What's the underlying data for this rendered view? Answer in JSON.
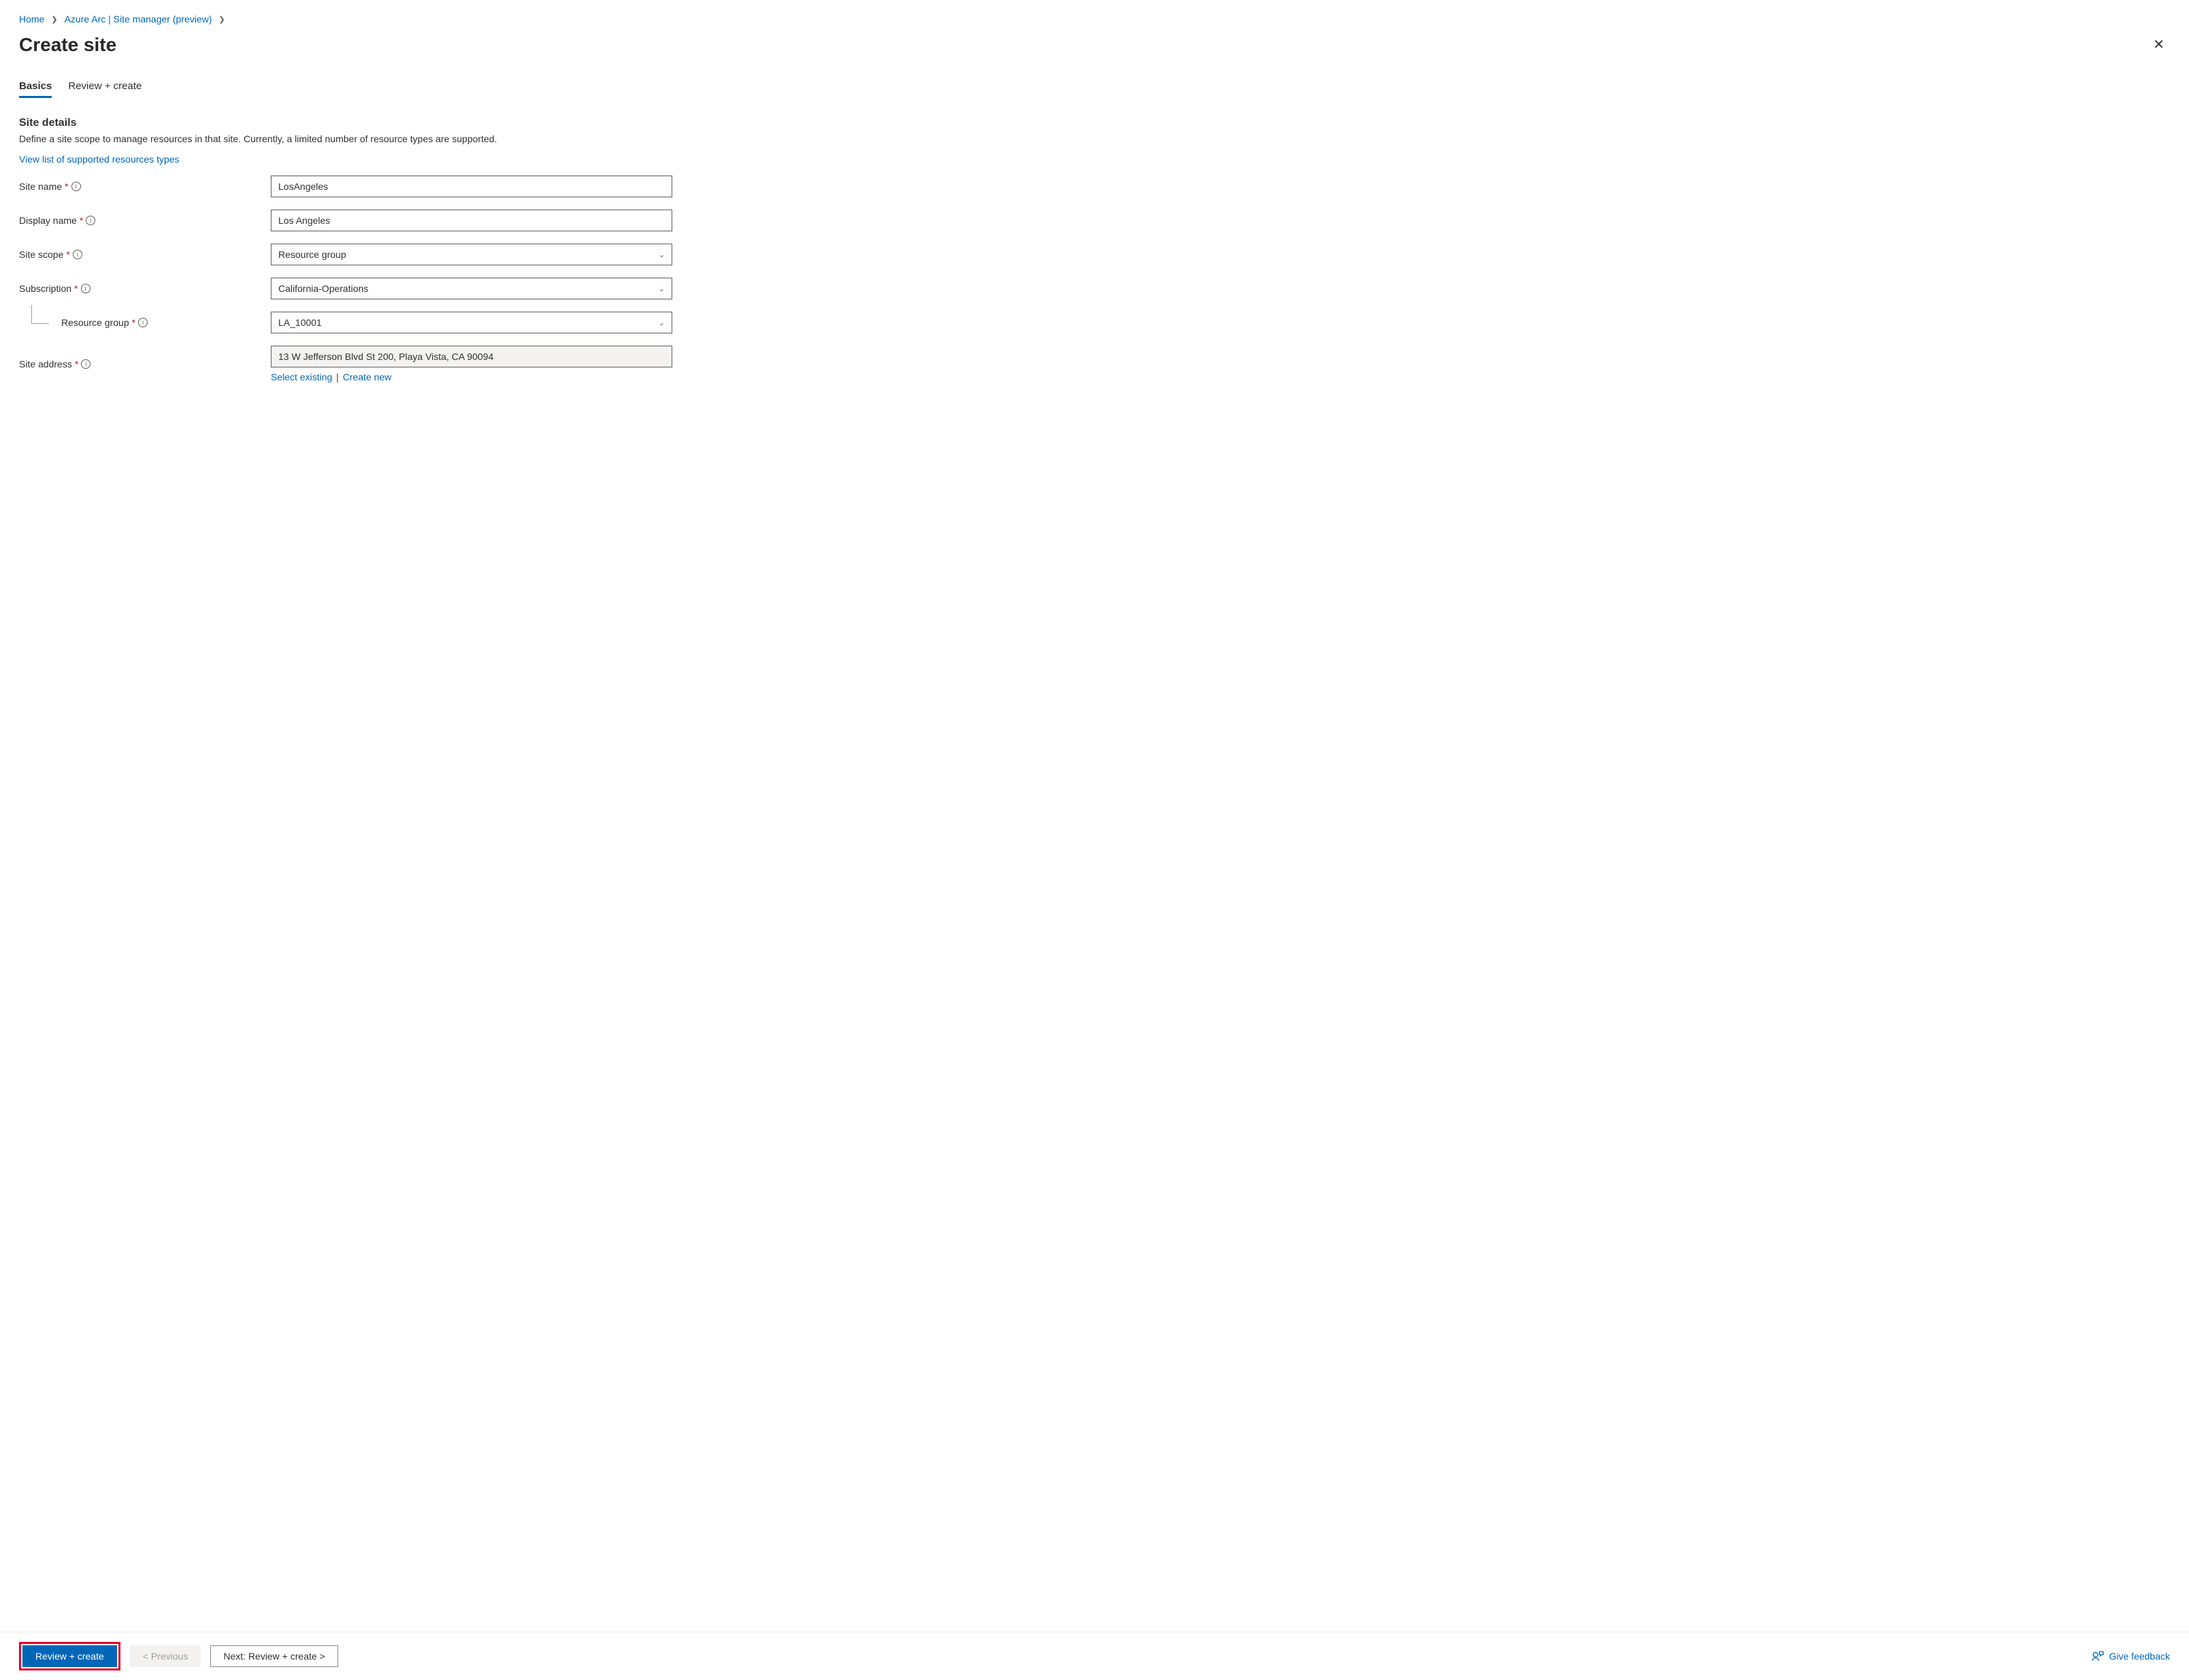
{
  "breadcrumb": {
    "home": "Home",
    "arc": "Azure Arc | Site manager (preview)"
  },
  "header": {
    "title": "Create site"
  },
  "tabs": {
    "basics": "Basics",
    "review": "Review + create"
  },
  "section": {
    "title": "Site details",
    "desc": "Define a site scope to manage resources in that site. Currently, a limited number of resource types are supported.",
    "supportedLink": "View list of supported resources types"
  },
  "form": {
    "siteName": {
      "label": "Site name",
      "value": "LosAngeles"
    },
    "displayName": {
      "label": "Display name",
      "value": "Los Angeles"
    },
    "siteScope": {
      "label": "Site scope",
      "value": "Resource group"
    },
    "subscription": {
      "label": "Subscription",
      "value": "California-Operations"
    },
    "resourceGroup": {
      "label": "Resource group",
      "value": "LA_10001"
    },
    "siteAddress": {
      "label": "Site address",
      "value": "13 W Jefferson Blvd St 200, Playa Vista, CA 90094",
      "selectExisting": "Select existing",
      "createNew": "Create new"
    }
  },
  "footer": {
    "reviewCreate": "Review + create",
    "previous": "< Previous",
    "next": "Next: Review + create >",
    "feedback": "Give feedback"
  }
}
